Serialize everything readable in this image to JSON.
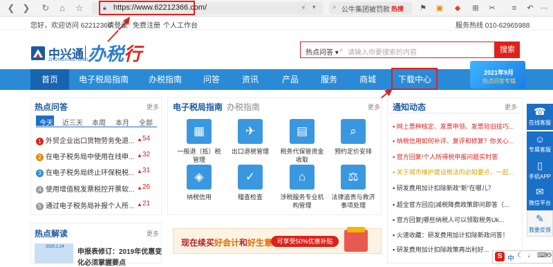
{
  "browser": {
    "url": "https://www.62212366.com/",
    "search_query": "公牛集团被罚款",
    "hot_badge": "热搜"
  },
  "topbar": {
    "welcome": "您好，欢迎访问 62212366",
    "login": "请登录",
    "register": "免费注册",
    "workspace": "个人工作台",
    "hotline": "服务热线 010-62965988"
  },
  "header": {
    "logo_text": "中兴通",
    "logo_sub": "ZHONGXINGTONG",
    "brand_a": "办税",
    "brand_b": "行",
    "search_category": "热点问答",
    "search_placeholder": "请输入你要搜索的内容",
    "search_button": "搜索"
  },
  "nav": {
    "items": [
      "首页",
      "电子税局指南",
      "办税指南",
      "问答",
      "资讯",
      "产品",
      "服务",
      "商城",
      "下载中心"
    ]
  },
  "promo": {
    "line1": "2021年9月",
    "line2": "热点问答专辑"
  },
  "hot_qa": {
    "title": "热点问答",
    "more": "更多",
    "tabs": [
      "今天",
      "近三天",
      "本周",
      "本月",
      "全部"
    ],
    "items": [
      {
        "num": "1",
        "text": "外贸企业出口货物劳务免退...",
        "count": "54"
      },
      {
        "num": "2",
        "text": "在电子税务局中使用在线申...",
        "count": "32"
      },
      {
        "num": "3",
        "text": "在电子税务局终止环保税税...",
        "count": "31"
      },
      {
        "num": "4",
        "text": "使用增值税发票税控开票软...",
        "count": "26"
      },
      {
        "num": "5",
        "text": "通过电子税务局补报个人所...",
        "count": "21"
      }
    ]
  },
  "guide": {
    "tab1": "电子税局指南",
    "tab2": "办税指南",
    "more": "更多",
    "items": [
      {
        "label": "一般退（抵）税管理",
        "icon": "grid-icon",
        "glyph": "▦"
      },
      {
        "label": "出口退税管理",
        "icon": "airplane-icon",
        "glyph": "✈"
      },
      {
        "label": "税务代保管资金收取",
        "icon": "document-icon",
        "glyph": "▤"
      },
      {
        "label": "预约定价安排",
        "icon": "search-icon",
        "glyph": "⌕"
      },
      {
        "label": "纳税信用",
        "icon": "shield-icon",
        "glyph": "◈"
      },
      {
        "label": "稽查检查",
        "icon": "check-icon",
        "glyph": "✓"
      },
      {
        "label": "涉税服务专业机构管理",
        "icon": "bank-icon",
        "glyph": "⌂"
      },
      {
        "label": "法律追责与救济事项处理",
        "icon": "scales-icon",
        "glyph": "⚖"
      }
    ]
  },
  "notices": {
    "title": "通知动态",
    "more": "更多",
    "items": [
      {
        "text": "网上票种核定、发票申领、发票验旧技巧...",
        "color": "#e0201b"
      },
      {
        "text": "纳税信用如何补评、复评和修复？你关心...",
        "color": "#e0201b"
      },
      {
        "text": "官方回复!个人所得税申报问题实时答",
        "color": "#e0201b"
      },
      {
        "text": "关于城市维护建设税法的必知要点，一起...",
        "color": "#d4a300"
      },
      {
        "text": "研发费用加计扣除新政“新”在哪儿？",
        "color": "#333333"
      },
      {
        "text": "超全官方回应|减税降费政策即问即答（...",
        "color": "#333333"
      },
      {
        "text": "官方回复|哪些纳税人可以领取税务Uk...",
        "color": "#333333"
      },
      {
        "text": "火速收藏：研发费用加计扣除新政问答！",
        "color": "#333333"
      },
      {
        "text": "研发费用加计扣除政策再出利好...",
        "color": "#333333"
      }
    ]
  },
  "hot_read": {
    "title": "热点解读",
    "more": "更多",
    "headline": "申报表修订：2019年优惠变",
    "headline2": "化必须掌握要点",
    "thumb_caption": "2020.1.24"
  },
  "banner": {
    "part1": "现在续买",
    "part2": "好会计",
    "part3": "和",
    "part4": "好生意",
    "button": "可享受50%优惠补贴"
  },
  "right_sidebar": {
    "items": [
      {
        "label": "在线客服",
        "glyph": "☎"
      },
      {
        "label": "专属客服",
        "glyph": "☺"
      },
      {
        "label": "手机APP",
        "glyph": "▯"
      },
      {
        "label": "微信平台",
        "glyph": "✉"
      },
      {
        "label": "我要反馈",
        "glyph": "✎"
      }
    ]
  },
  "ime": {
    "label": "中"
  }
}
